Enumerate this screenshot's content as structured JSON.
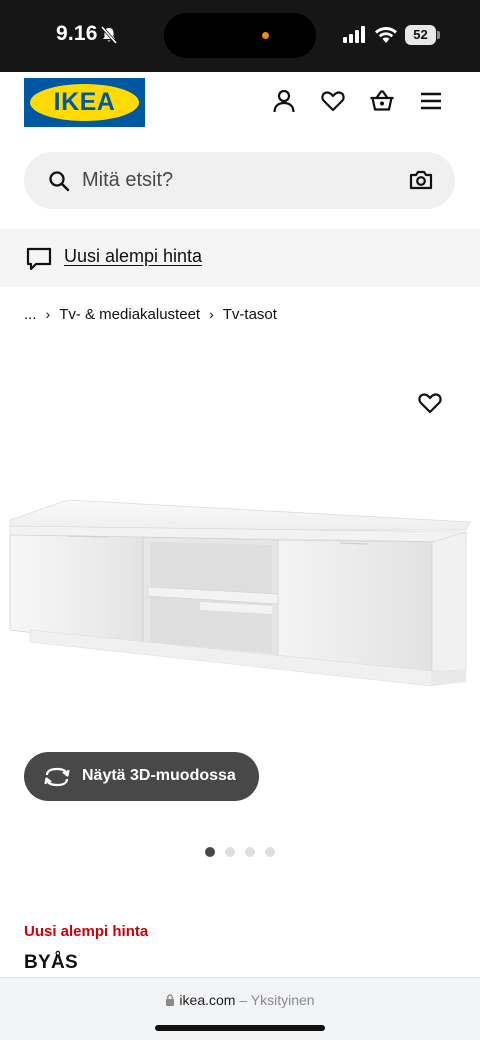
{
  "status_bar": {
    "time": "9.16",
    "battery": "52"
  },
  "header": {
    "logo_text": "IKEA"
  },
  "search": {
    "placeholder": "Mitä etsit?"
  },
  "promo": {
    "link_text": "Uusi alempi hinta"
  },
  "breadcrumb": {
    "ellipsis": "...",
    "items": [
      "Tv- & mediakalusteet",
      "Tv-tasot"
    ]
  },
  "gallery": {
    "view_3d_label": "Näytä 3D-muodossa",
    "image_count": 4,
    "active_index": 0
  },
  "product": {
    "price_tag": "Uusi alempi hinta",
    "name": "BYÅS"
  },
  "browser": {
    "domain": "ikea.com",
    "suffix": "– Yksityinen"
  },
  "colors": {
    "brand_blue": "#0058a3",
    "brand_yellow": "#ffdb00",
    "price_red": "#cc0008",
    "button_dark": "#484848"
  }
}
